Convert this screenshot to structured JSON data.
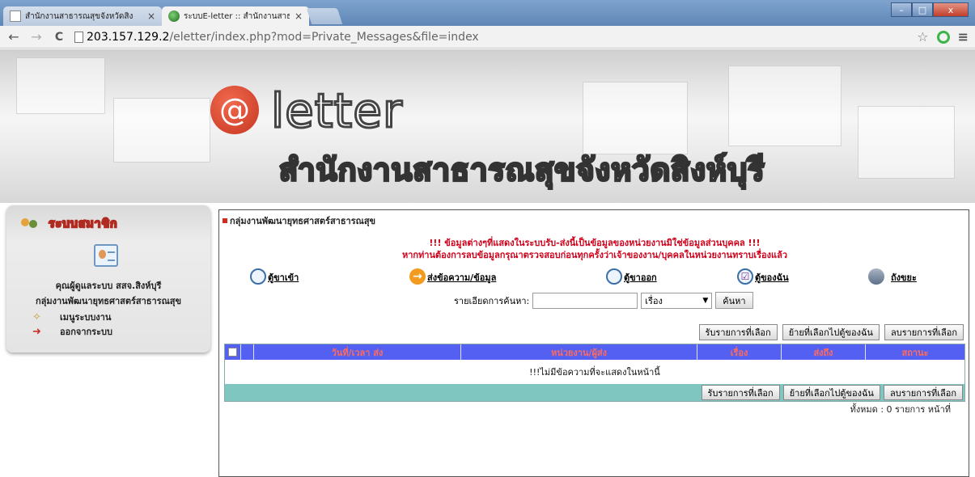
{
  "browser": {
    "tabs": [
      {
        "title": "สำนักงานสาธารณสุขจังหวัดสิง",
        "close": "×",
        "active": false
      },
      {
        "title": "ระบบE-letter :: สำนักงานสาธ",
        "close": "×",
        "active": true
      }
    ],
    "window_buttons": {
      "minimize": "–",
      "maximize": "□",
      "close": "x"
    },
    "nav": {
      "back": "←",
      "forward": "→",
      "reload": "C"
    },
    "url_host": "203.157.129.2",
    "url_path": "/eletter/index.php?mod=Private_Messages&file=index",
    "star": "☆",
    "menu": "≡"
  },
  "banner": {
    "logo_symbol": "@",
    "logo_text": "letter",
    "office_name": "สำนักงานสาธารณสุขจังหวัดสิงห์บุรี"
  },
  "sidebar": {
    "title": "ระบบสมาชิก",
    "user_line": "คุณผู้ดูแลระบบ สสจ.สิงห์บุรี",
    "group_line": "กลุ่มงานพัฒนายุทธศาสตร์สาธารณสุข",
    "menu": [
      {
        "label": "เมนูระบบงาน",
        "icon": "wrench-icon"
      },
      {
        "label": "ออกจากระบบ",
        "icon": "logout-icon"
      }
    ]
  },
  "main": {
    "section_title": "กลุ่มงานพัฒนายุทธศาสตร์สาธารณสุข",
    "warning_1": "!!! ข้อมูลต่างๆที่แสดงในระบบรับ-ส่งนี้เป็นข้อมูลของหน่วยงานมิใช่ข้อมูลส่วนบุคคล !!!",
    "warning_2": "หากท่านต้องการลบข้อมูลกรุณาตรวจสอบก่อนทุกครั้งว่าเจ้าของงาน/บุคคลในหน่วยงานทราบเรื่องแล้ว",
    "nav": [
      {
        "label": "ตู้ขาเข้า",
        "icon": "inbox-icon"
      },
      {
        "label": "ส่งข้อความ/ข้อมูล",
        "icon": "send-icon"
      },
      {
        "label": "ตู้ขาออก",
        "icon": "outbox-icon"
      },
      {
        "label": "ตู้ของฉัน",
        "icon": "mybox-icon"
      },
      {
        "label": "ถังขยะ",
        "icon": "trash-icon"
      }
    ],
    "search": {
      "label": "รายเอียดการค้นหา:",
      "value": "",
      "select_value": "เรื่อง",
      "select_arrow": "▼",
      "button": "ค้นหา"
    },
    "actions": {
      "receive": "รับรายการที่เลือก",
      "move": "ย้ายที่เลือกไปตู้ของฉัน",
      "delete": "ลบรายการที่เลือก"
    },
    "table": {
      "columns": [
        "วันที่/เวลา ส่ง",
        "หน่วยงาน/ผู้ส่ง",
        "เรื่อง",
        "ส่งถึง",
        "สถานะ"
      ],
      "empty_message": "!!!ไม่มีข้อความที่จะแสดงในหน้านี้"
    },
    "pager": "ทั้งหมด : 0 รายการ หน้าที่"
  }
}
